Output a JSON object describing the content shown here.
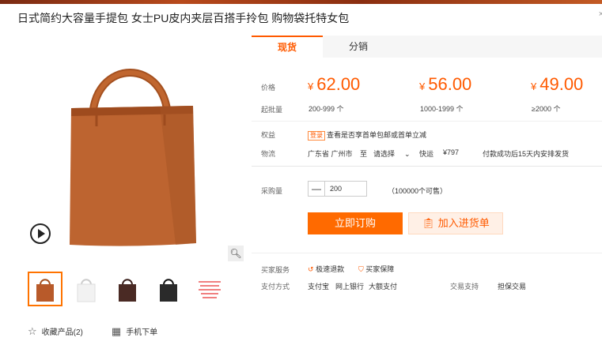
{
  "title": "日式简约大容量手提包 女士PU皮内夹层百搭手拎包 购物袋托特女包",
  "close_glyph": "×",
  "tabs": [
    "现货",
    "分销"
  ],
  "labels": {
    "price": "价格",
    "moq": "起批量",
    "rights": "权益",
    "logistics": "物流",
    "purchase_qty": "采购量",
    "buyer_service": "买家服务",
    "payment": "支付方式",
    "trade_support": "交易支持"
  },
  "prices": [
    {
      "currency": "¥",
      "value": "62.00",
      "range": "200-999 个"
    },
    {
      "currency": "¥",
      "value": "56.00",
      "range": "1000-1999 个"
    },
    {
      "currency": "¥",
      "value": "49.00",
      "range": "≥2000 个"
    }
  ],
  "rights": {
    "badge": "登录",
    "text": "查看是否享首单包邮或首单立减"
  },
  "logistics": {
    "origin": "广东省 广州市",
    "to": "至",
    "dest_placeholder": "请选择",
    "method": "快运",
    "fee": "¥797",
    "note": "付款成功后15天内安排发货"
  },
  "quantity": {
    "minus": "—",
    "value": "200",
    "available": "（100000个可售）"
  },
  "buttons": {
    "buy_now": "立即订购",
    "add_to_cart": "加入进货单"
  },
  "services": [
    "极速退款",
    "买家保障"
  ],
  "payment": [
    "支付宝",
    "网上银行",
    "大额支付"
  ],
  "trade_support": "担保交易",
  "bottom": {
    "favorite": "收藏产品(2)",
    "mobile_order": "手机下单"
  },
  "thumbnail_colors": [
    "#b85a2a",
    "#f2f2f2",
    "#4a2a24",
    "#2a2a2a"
  ],
  "colors": {
    "accent": "#ff5a00"
  }
}
